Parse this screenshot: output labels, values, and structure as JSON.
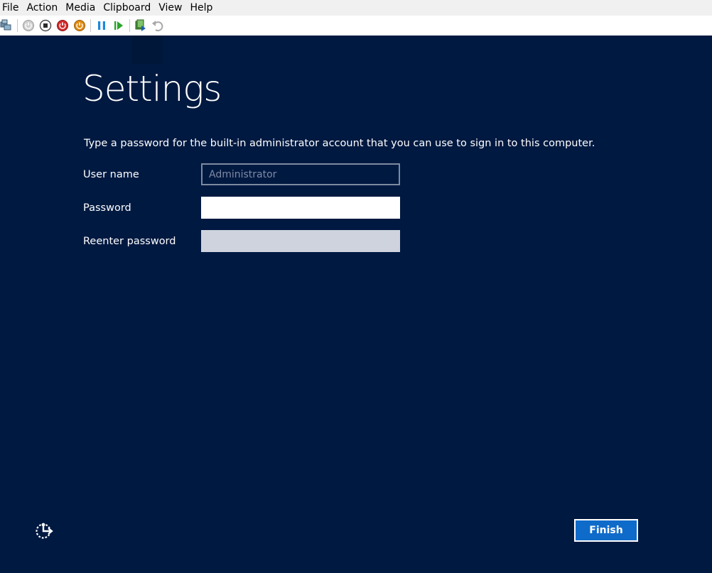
{
  "menu": {
    "items": [
      "File",
      "Action",
      "Media",
      "Clipboard",
      "View",
      "Help"
    ]
  },
  "toolbar": {
    "buttons": [
      "ctrl-alt-del-icon",
      "start-icon",
      "turn-off-icon",
      "shut-down-icon",
      "save-icon",
      "pause-icon",
      "reset-icon",
      "checkpoint-icon",
      "revert-icon"
    ]
  },
  "page": {
    "title": "Settings",
    "description": "Type a password for the built-in administrator account that you can use to sign in to this computer."
  },
  "form": {
    "username_label": "User name",
    "username_value": "Administrator",
    "password_label": "Password",
    "password_value": "",
    "reenter_label": "Reenter password",
    "reenter_value": ""
  },
  "footer": {
    "finish_label": "Finish"
  },
  "colors": {
    "background": "#001941",
    "accent": "#0f6bc9",
    "menubar": "#f0f0f0"
  }
}
